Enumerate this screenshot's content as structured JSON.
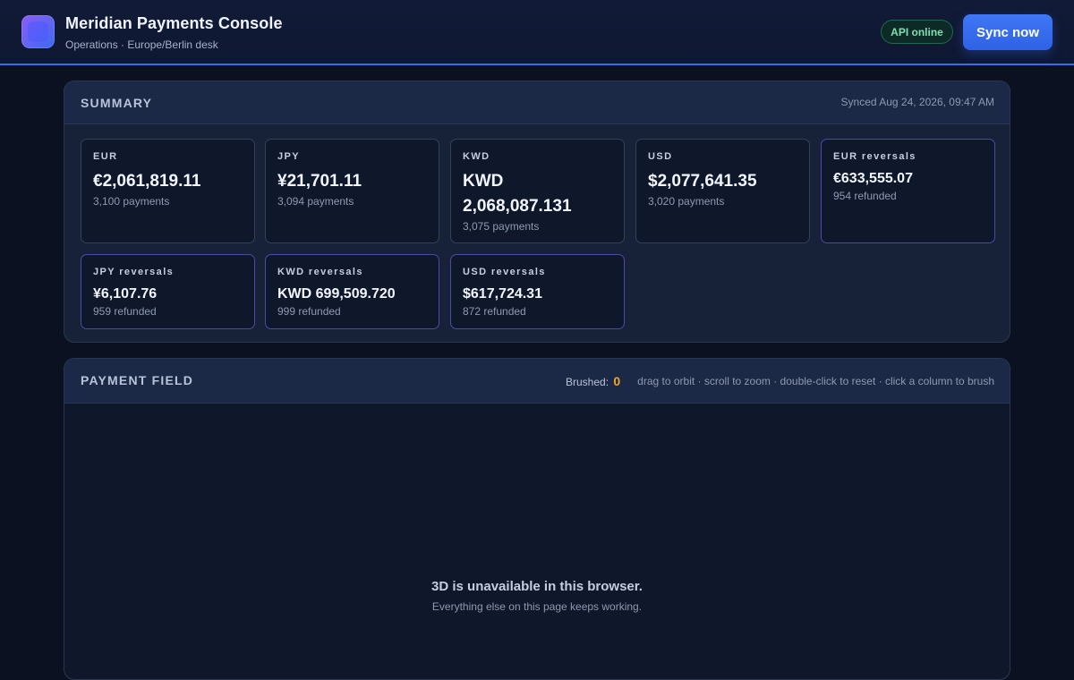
{
  "header": {
    "title": "Meridian Payments Console",
    "subtitle": "Operations · Europe/Berlin desk",
    "status_badge": "API online",
    "sync_label": "Sync now"
  },
  "summary": {
    "title": "SUMMARY",
    "synced": "Synced Aug 24, 2026, 09:47 AM",
    "cards": [
      {
        "label": "EUR",
        "value": "€2,061,819.11",
        "sub": "3,100 payments"
      },
      {
        "label": "JPY",
        "value": "¥21,701.11",
        "sub": "3,094 payments"
      },
      {
        "label": "KWD",
        "value": "KWD 2,068,087.131",
        "sub": "3,075 payments"
      },
      {
        "label": "USD",
        "value": "$2,077,641.35",
        "sub": "3,020 payments"
      },
      {
        "label": "EUR reversals",
        "value": "€633,555.07",
        "sub": "954 refunded"
      },
      {
        "label": "JPY reversals",
        "value": "¥6,107.76",
        "sub": "959 refunded"
      },
      {
        "label": "KWD reversals",
        "value": "KWD 699,509.720",
        "sub": "999 refunded"
      },
      {
        "label": "USD reversals",
        "value": "$617,724.31",
        "sub": "872 refunded"
      }
    ]
  },
  "field": {
    "title": "PAYMENT FIELD",
    "brushed_label": "Brushed:",
    "brushed_count": "0",
    "hint": "drag to orbit · scroll to zoom · double-click to reset · click a column to brush",
    "unavailable_title": "3D is unavailable in this browser.",
    "unavailable_sub": "Everything else on this page keeps working."
  },
  "colors": {
    "accent": "#3b6cf0",
    "status_ok": "#7ee0b0",
    "brushed": "#f5a623"
  }
}
